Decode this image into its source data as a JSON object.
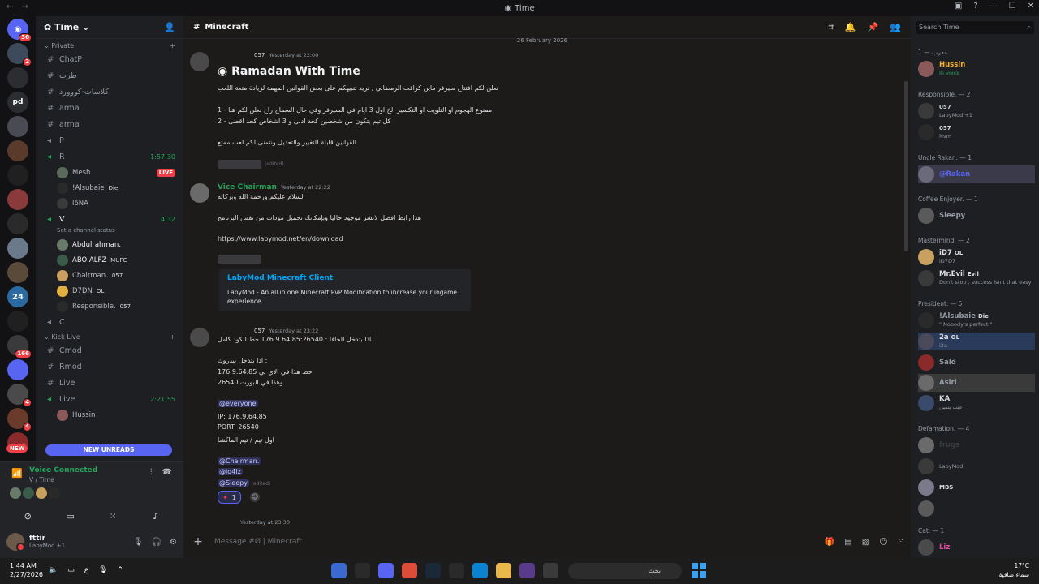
{
  "window": {
    "title": "Time"
  },
  "rail": {
    "badges": [
      "36",
      "2",
      "166",
      "4",
      "4"
    ]
  },
  "server": {
    "name": "Time",
    "categories": {
      "private": "Private",
      "kick_live": "Kick Live"
    },
    "channels": [
      {
        "name": "ChatP"
      },
      {
        "name": "طرب"
      },
      {
        "name": "كلاسات-كووورد"
      },
      {
        "name": "arma"
      },
      {
        "name": "arma"
      },
      {
        "name": "P"
      },
      {
        "name": "R",
        "time": "1:57:30"
      },
      {
        "name": "V",
        "time": "4:32"
      },
      {
        "name": "C"
      },
      {
        "name": "Cmod"
      },
      {
        "name": "Rmod"
      },
      {
        "name": "Live"
      },
      {
        "name": "Live",
        "time": "2:21:55"
      }
    ],
    "r_users": [
      {
        "name": "Mesh",
        "live": "LIVE"
      },
      {
        "name": "!Alsubaie",
        "tag": "Die"
      },
      {
        "name": "l6NA"
      }
    ],
    "v_status": "Set a channel status",
    "v_users": [
      {
        "name": "Abdulrahman."
      },
      {
        "name": "ABO ALFZ",
        "tag": "MUFC"
      },
      {
        "name": "Chairman.",
        "tag": "057"
      },
      {
        "name": "D7DN",
        "tag": "OL"
      },
      {
        "name": "Responsible.",
        "tag": "057"
      }
    ],
    "live_user": "Hussin",
    "new_unreads": "NEW UNREADS",
    "new_badge": "NEW"
  },
  "voice": {
    "status": "Voice Connected",
    "channel": "V / Time"
  },
  "user": {
    "name": "fttir",
    "status": "LabyMod +1"
  },
  "channel": {
    "name": "Minecraft",
    "date_divider": "26 February 2026",
    "composer_placeholder": "Message #Ø | Minecraft"
  },
  "messages": {
    "m1": {
      "tag": "057",
      "timestamp": "Yesterday at 22:00",
      "title": "Ramadan With Time",
      "line1": "نعلن لكم افتتاح سيرفر ماين كرافت الرمضاني , نريد تنبيهكم على بعض القوانين المهمة لزيادة متعة اللعب",
      "line2": "ممنوع الهجوم او التلويت او التكسير الخ اول 3 ايام في السيرفر وفي حال السماح راح نعلن لكم هنا - 1",
      "line3": "كل تيم يتكون من شخصين كحد ادنى و 3 اشخاص كحد اقصى - 2",
      "line4": "القوانين قابلة للتغيير والتعديل ونتمنى لكم لعب ممتع",
      "edited": "(edited)"
    },
    "m2": {
      "author": "Vice Chairman",
      "timestamp": "Yesterday at 22:22",
      "line1": "السلام عليكم ورحمة الله وبركاته",
      "line2": "هذا رابط افضل لانشر موجود حاليا وبإمكانك تحميل مودات من نفس البرنامج",
      "link": "https://www.labymod.net/en/download",
      "embed_title": "LabyMod Minecraft Client",
      "embed_desc": "LabyMod - An all in one Minecraft PvP Modification to increase your ingame experience"
    },
    "m3": {
      "tag": "057",
      "timestamp": "Yesterday at 23:22",
      "line1": "اذا بتدخل الجافا : 176.9.64.85:26540 حط الكود كامل",
      "line2": "اذا بتدخل بيدروك :",
      "line3": "176.9.64.85 حط هذا في الاي بي",
      "line4": "26540 وهذا في البورت",
      "everyone": "@everyone",
      "ip": "IP: 176.9.64.85",
      "port": "PORT: 26540",
      "line5": "اول تيم / تيم الماكشا",
      "mention1": "@Chairman.",
      "mention2": "@iq4lz",
      "mention3": "@Sleepy",
      "edited": "(edited)",
      "reaction_count": "1"
    },
    "m4": {
      "timestamp": "Yesterday at 23:30"
    }
  },
  "members": {
    "search_placeholder": "Search Time",
    "roles": [
      {
        "label": "معرب — 1"
      },
      {
        "label": "Responsible. — 2"
      },
      {
        "label": "Uncle Rakan. — 1"
      },
      {
        "label": "Coffee Enjoyer. — 1"
      },
      {
        "label": "Mastermind. — 2"
      },
      {
        "label": "President. — 5"
      },
      {
        "label": "Defamation. — 4"
      },
      {
        "label": "Cat. — 1"
      }
    ],
    "list": [
      {
        "name": "Hussin",
        "sub": "In voice"
      },
      {
        "name": "",
        "tag": "057",
        "sub": "LabyMod +1"
      },
      {
        "name": "",
        "tag": "057",
        "sub": "Nvm"
      },
      {
        "name": "@Rakan"
      },
      {
        "name": "Sleepy"
      },
      {
        "name": "iD7",
        "tag": "OL",
        "sub": "iD7D7"
      },
      {
        "name": "Mr.Evil",
        "tag": "Evil",
        "sub": "Don't stop , success isn't that easy"
      },
      {
        "name": "!Alsubaie",
        "tag": "Die",
        "sub": "\" Nobody's perfect \""
      },
      {
        "name": "2a",
        "tag": "OL",
        "sub": "i2a"
      },
      {
        "name": "Sald"
      },
      {
        "name": "Asiri"
      },
      {
        "name": "KA",
        "sub": "عيب يتمين"
      },
      {
        "name": "frugs"
      },
      {
        "name": "",
        "sub": "LabyMod"
      },
      {
        "name": "",
        "tag": "MBS"
      },
      {
        "name": ""
      },
      {
        "name": "Liz"
      }
    ]
  },
  "taskbar": {
    "time": "1:44 AM",
    "date": "2/27/2026",
    "lang": "ع",
    "search": "بحث",
    "temp": "17°C",
    "weather": "سماء صافية"
  }
}
